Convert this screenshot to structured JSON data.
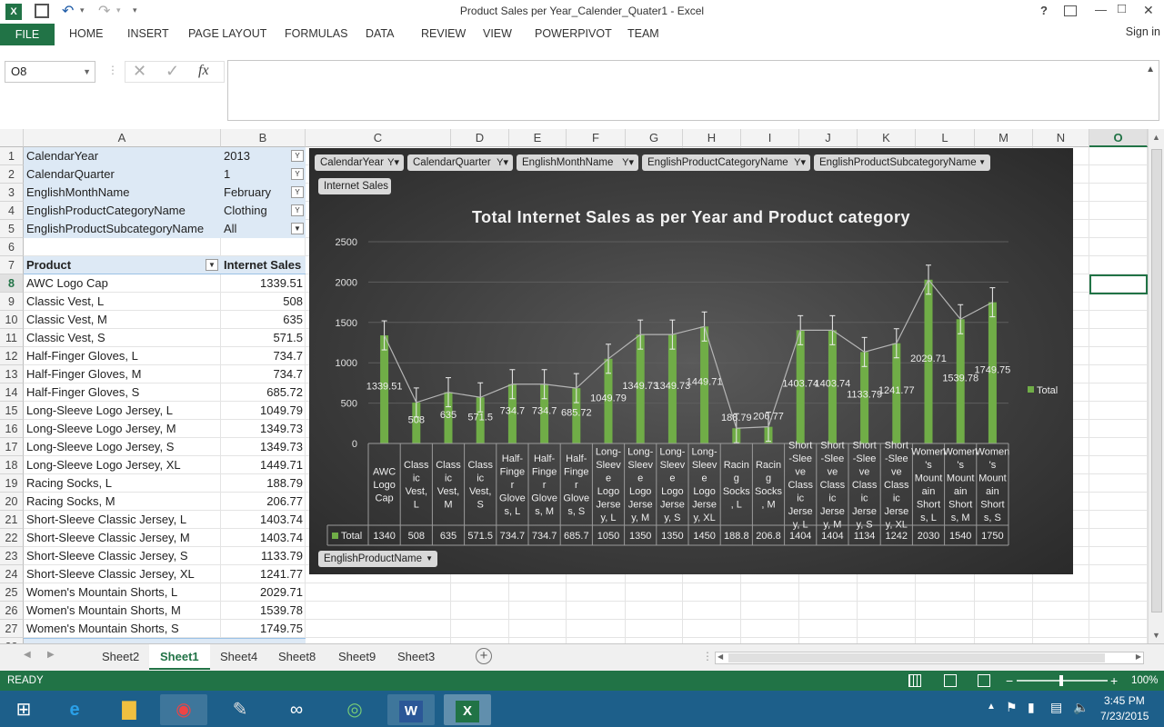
{
  "window": {
    "title": "Product Sales per Year_Calender_Quater1 - Excel",
    "help_label": "?",
    "min_label": "—",
    "max_label": "□",
    "close_label": "✕"
  },
  "ribbon": {
    "file": "FILE",
    "tabs": [
      "HOME",
      "INSERT",
      "PAGE LAYOUT",
      "FORMULAS",
      "DATA",
      "REVIEW",
      "VIEW",
      "POWERPIVOT",
      "TEAM"
    ],
    "sign_in": "Sign in"
  },
  "formula_bar": {
    "name_box": "O8",
    "fx": "fx",
    "value": ""
  },
  "columns": [
    "A",
    "B",
    "C",
    "D",
    "E",
    "F",
    "G",
    "H",
    "I",
    "J",
    "K",
    "L",
    "M",
    "N",
    "O"
  ],
  "filters": [
    {
      "field": "CalendarYear",
      "value": "2013"
    },
    {
      "field": "CalendarQuarter",
      "value": "1"
    },
    {
      "field": "EnglishMonthName",
      "value": "February"
    },
    {
      "field": "EnglishProductCategoryName",
      "value": "Clothing"
    },
    {
      "field": "EnglishProductSubcategoryName",
      "value": "All"
    }
  ],
  "pivot": {
    "header_product": "Product",
    "header_sales": "Internet Sales",
    "rows": [
      {
        "product": "AWC Logo Cap",
        "sales": "1339.51"
      },
      {
        "product": "Classic Vest, L",
        "sales": "508"
      },
      {
        "product": "Classic Vest, M",
        "sales": "635"
      },
      {
        "product": "Classic Vest, S",
        "sales": "571.5"
      },
      {
        "product": "Half-Finger Gloves, L",
        "sales": "734.7"
      },
      {
        "product": "Half-Finger Gloves, M",
        "sales": "734.7"
      },
      {
        "product": "Half-Finger Gloves, S",
        "sales": "685.72"
      },
      {
        "product": "Long-Sleeve Logo Jersey, L",
        "sales": "1049.79"
      },
      {
        "product": "Long-Sleeve Logo Jersey, M",
        "sales": "1349.73"
      },
      {
        "product": "Long-Sleeve Logo Jersey, S",
        "sales": "1349.73"
      },
      {
        "product": "Long-Sleeve Logo Jersey, XL",
        "sales": "1449.71"
      },
      {
        "product": "Racing Socks, L",
        "sales": "188.79"
      },
      {
        "product": "Racing Socks, M",
        "sales": "206.77"
      },
      {
        "product": "Short-Sleeve Classic Jersey, L",
        "sales": "1403.74"
      },
      {
        "product": "Short-Sleeve Classic Jersey, M",
        "sales": "1403.74"
      },
      {
        "product": "Short-Sleeve Classic Jersey, S",
        "sales": "1133.79"
      },
      {
        "product": "Short-Sleeve Classic Jersey, XL",
        "sales": "1241.77"
      },
      {
        "product": "Women's Mountain Shorts, L",
        "sales": "2029.71"
      },
      {
        "product": "Women's Mountain Shorts, M",
        "sales": "1539.78"
      },
      {
        "product": "Women's Mountain Shorts, S",
        "sales": "1749.75"
      }
    ]
  },
  "chart_field_buttons": [
    "CalendarYear",
    "CalendarQuarter",
    "EnglishMonthName",
    "EnglishProductCategoryName",
    "EnglishProductSubcategoryName"
  ],
  "chart_value_button": "Internet Sales",
  "chart_axis_button": "EnglishProductName",
  "chart_data": {
    "type": "bar",
    "title": "Total Internet Sales as per Year and Product category",
    "categories": [
      "AWC Logo Cap",
      "Classic Vest, L",
      "Classic Vest, M",
      "Classic Vest, S",
      "Half-Finger Gloves, L",
      "Half-Finger Gloves, M",
      "Half-Finger Gloves, S",
      "Long-Sleeve Logo Jersey, L",
      "Long-Sleeve Logo Jersey, M",
      "Long-Sleeve Logo Jersey, S",
      "Long-Sleeve Logo Jersey, XL",
      "Racing Socks, L",
      "Racing Socks, M",
      "Short-Sleeve Classic Jersey, L",
      "Short-Sleeve Classic Jersey, M",
      "Short-Sleeve Classic Jersey, S",
      "Short-Sleeve Classic Jersey, XL",
      "Women's Mountain Shorts, L",
      "Women's Mountain Shorts, M",
      "Women's Mountain Shorts, S"
    ],
    "series": [
      {
        "name": "Total",
        "values": [
          1339.51,
          508,
          635,
          571.5,
          734.7,
          734.7,
          685.72,
          1049.79,
          1349.73,
          1349.73,
          1449.71,
          188.79,
          206.77,
          1403.74,
          1403.74,
          1133.79,
          1241.77,
          2029.71,
          1539.78,
          1749.75
        ]
      }
    ],
    "data_labels": [
      "1339.51",
      "508",
      "635",
      "571.5",
      "734.7",
      "734.7",
      "685.72",
      "1049.79",
      "1349.73",
      "1349.73",
      "1449.71",
      "188.79",
      "206.77",
      "1403.74",
      "1403.74",
      "1133.79",
      "1241.77",
      "2029.71",
      "1539.78",
      "1749.75"
    ],
    "table_values": [
      "1340",
      "508",
      "635",
      "571.5",
      "734.7",
      "734.7",
      "685.7",
      "1050",
      "1350",
      "1350",
      "1450",
      "188.8",
      "206.8",
      "1404",
      "1404",
      "1134",
      "1242",
      "2030",
      "1540",
      "1750"
    ],
    "table_row_label": "Total",
    "ylim": [
      0,
      2500
    ],
    "yticks": [
      "0",
      "500",
      "1000",
      "1500",
      "2000",
      "2500"
    ],
    "legend": "right",
    "grid": true,
    "color_bar": "#70ad47"
  },
  "sheets": [
    "Sheet2",
    "Sheet1",
    "Sheet4",
    "Sheet8",
    "Sheet9",
    "Sheet3"
  ],
  "active_sheet": "Sheet1",
  "status": {
    "ready": "READY",
    "zoom": "100%"
  },
  "taskbar": {
    "time": "3:45 PM",
    "date": "7/23/2015"
  }
}
